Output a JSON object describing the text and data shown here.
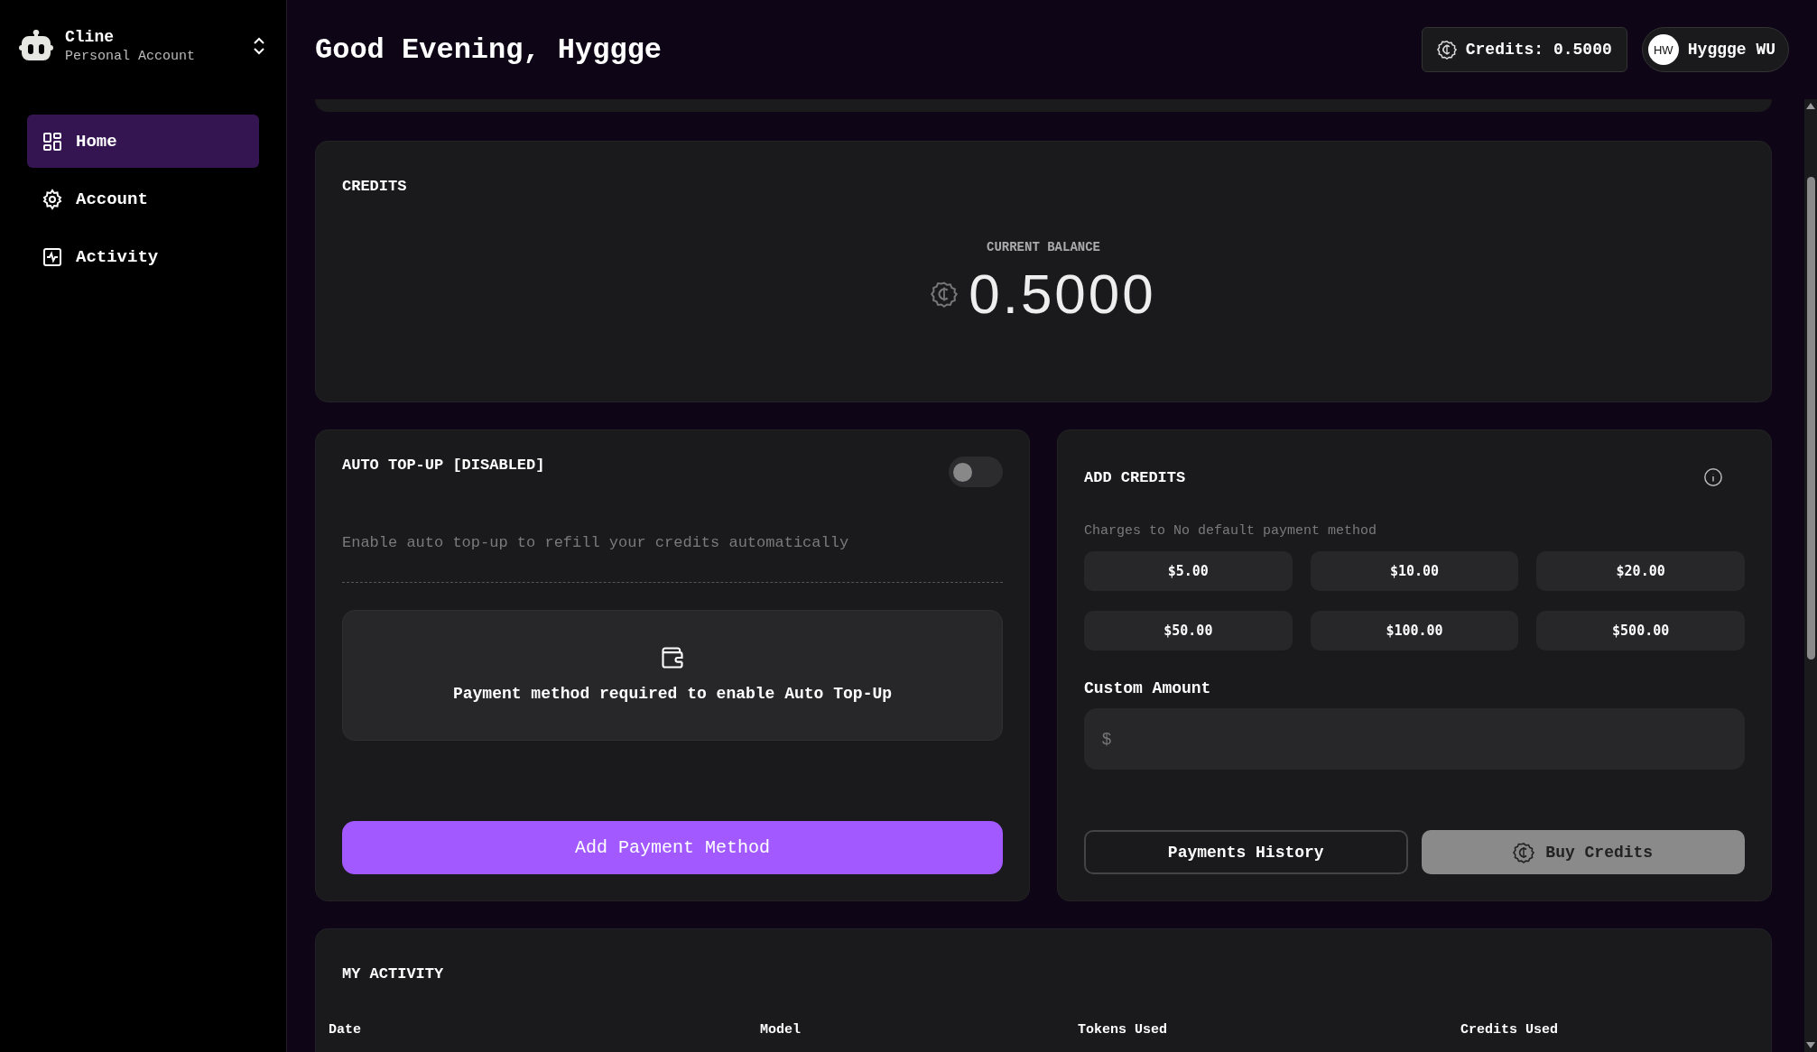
{
  "sidebar": {
    "account": {
      "name": "Cline",
      "subtitle": "Personal Account"
    },
    "items": [
      {
        "label": "Home",
        "kind": "grid",
        "selected": true
      },
      {
        "label": "Account",
        "kind": "gear",
        "selected": false
      },
      {
        "label": "Activity",
        "kind": "pulse",
        "selected": false
      }
    ]
  },
  "header": {
    "greeting": "Good Evening, Hyggge",
    "credits": "Credits: 0.5000",
    "user": {
      "initials": "HW",
      "name": "Hyggge WU"
    }
  },
  "credits_card": {
    "title": "CREDITS",
    "balance_label": "CURRENT BALANCE",
    "balance": "0.5000"
  },
  "auto_topup": {
    "title": "AUTO TOP-UP [DISABLED]",
    "on": false,
    "description": "Enable auto top-up to refill your credits automatically",
    "notice": "Payment method required to enable Auto Top-Up",
    "button": "Add Payment Method"
  },
  "add_credits": {
    "title": "ADD CREDITS",
    "charges": "Charges to No default payment method",
    "amounts": [
      "$5.00",
      "$10.00",
      "$20.00",
      "$50.00",
      "$100.00",
      "$500.00"
    ],
    "custom_label": "Custom Amount",
    "placeholder": "$",
    "buttons": [
      {
        "label": "Payments History",
        "kind": "outline",
        "disabled": false
      },
      {
        "label": "Buy Credits",
        "kind": "buy",
        "disabled": true
      }
    ]
  },
  "activity": {
    "title": "MY ACTIVITY",
    "columns": [
      "Date",
      "Model",
      "Tokens Used",
      "Credits Used"
    ]
  }
}
